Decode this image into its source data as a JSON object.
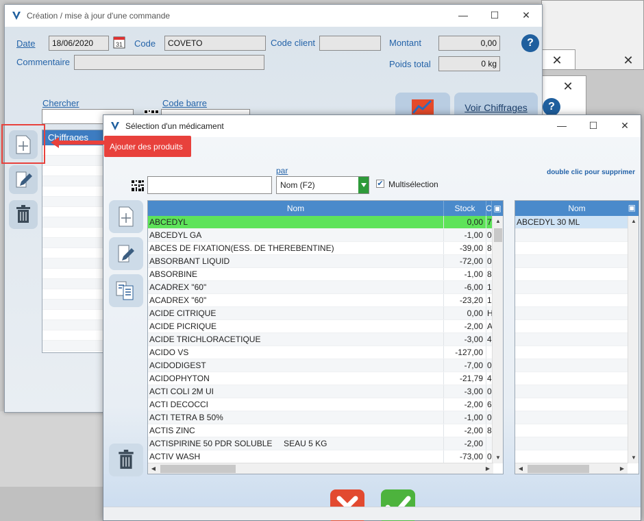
{
  "main_window": {
    "title": "Création / mise à jour d'une commande",
    "date_label": "Date",
    "date_value": "18/06/2020",
    "calendar_day": "31",
    "code_label": "Code",
    "code_value": "COVETO",
    "code_client_label": "Code client",
    "code_client_value": "",
    "montant_label": "Montant",
    "montant_value": "0,00",
    "commentaire_label": "Commentaire",
    "commentaire_value": "",
    "poids_label": "Poids total",
    "poids_value": "0 kg",
    "chercher_label": "Chercher",
    "code_barre_label": "Code barre",
    "grid_header": "Chiffrages",
    "voir_chiffrages_label": "Voir Chiffrages",
    "help": "?"
  },
  "tooltip": {
    "text": "Ajouter des produits"
  },
  "dialog": {
    "title": "Sélection d'un médicament",
    "par_label": "par",
    "search_value": "",
    "search_mode": "Nom (F2)",
    "multiselection_label": "Multisélection",
    "multiselection_checked": true,
    "hint": "double clic pour supprimer",
    "table_headers": {
      "nom": "Nom",
      "stock": "Stock",
      "c": "C"
    },
    "rows": [
      {
        "nom": "ABCEDYL",
        "stock": "0,00",
        "c": "7",
        "selected": true
      },
      {
        "nom": "ABCEDYL GA",
        "stock": "-1,00",
        "c": "0"
      },
      {
        "nom": "ABCES DE FIXATION(ESS. DE THEREBENTINE)",
        "stock": "-39,00",
        "c": "8"
      },
      {
        "nom": "ABSORBANT LIQUID",
        "stock": "-72,00",
        "c": "0"
      },
      {
        "nom": "ABSORBINE",
        "stock": "-1,00",
        "c": "8"
      },
      {
        "nom": "ACADREX \"60\"",
        "stock": "-6,00",
        "c": "1"
      },
      {
        "nom": "ACADREX \"60\"",
        "stock": "-23,20",
        "c": "1"
      },
      {
        "nom": "ACIDE CITRIQUE",
        "stock": "0,00",
        "c": "H"
      },
      {
        "nom": "ACIDE PICRIQUE",
        "stock": "-2,00",
        "c": "A"
      },
      {
        "nom": "ACIDE TRICHLORACETIQUE",
        "stock": "-3,00",
        "c": "4"
      },
      {
        "nom": "ACIDO VS",
        "stock": "-127,00",
        "c": ""
      },
      {
        "nom": "ACIDODIGEST",
        "stock": "-7,00",
        "c": "0"
      },
      {
        "nom": "ACIDOPHYTON",
        "stock": "-21,79",
        "c": "4"
      },
      {
        "nom": "ACTI COLI 2M UI",
        "stock": "-3,00",
        "c": "0"
      },
      {
        "nom": "ACTI DECOCCI",
        "stock": "-2,00",
        "c": "6"
      },
      {
        "nom": "ACTI TETRA B 50%",
        "stock": "-1,00",
        "c": "0"
      },
      {
        "nom": "ACTIS ZINC",
        "stock": "-2,00",
        "c": "8"
      },
      {
        "nom": "ACTISPIRINE 50 PDR SOLUBLE     SEAU 5 KG",
        "stock": "-2,00",
        "c": ""
      },
      {
        "nom": "ACTIV WASH",
        "stock": "-73,00",
        "c": "0"
      }
    ],
    "selection_header": "Nom",
    "selection_rows": [
      "ABCEDYL 30 ML"
    ]
  },
  "colors": {
    "accent": "#2463a8",
    "header_blue": "#4a8acb",
    "selected_row": "#5ee35a",
    "tooltip_red": "#e8413c",
    "cancel_red": "#e24a30",
    "ok_green": "#4db33d"
  },
  "icons": [
    "logo-icon",
    "calendar-icon",
    "help-icon",
    "barcode-icon",
    "add-document-icon",
    "edit-icon",
    "trash-icon",
    "duplicate-icon",
    "cancel-icon",
    "check-icon",
    "dropdown-arrow-icon",
    "column-settings-icon",
    "delete-column-icon"
  ]
}
